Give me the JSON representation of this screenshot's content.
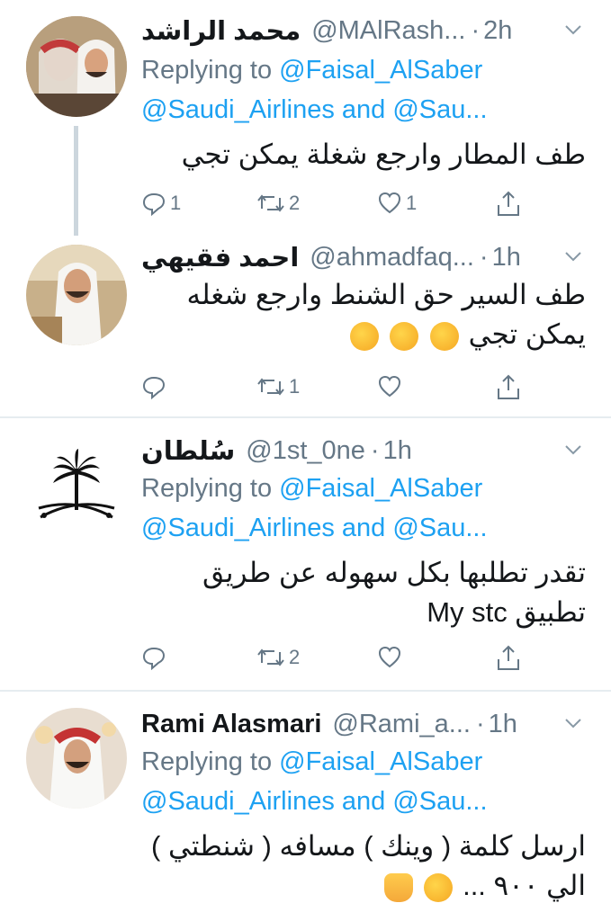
{
  "tweets": [
    {
      "name": "محمد الراشد",
      "handle": "@MAlRash...",
      "time": "2h",
      "replying_prefix": "Replying to",
      "replying_line1": "@Faisal_AlSaber",
      "replying_line2": "@Saudi_Airlines and @Sau...",
      "body": [
        "طف المطار وارجع شغلة يمكن تجي"
      ],
      "counts": {
        "reply": "1",
        "retweet": "2",
        "like": "1"
      },
      "avatar_icon": "person-photo-avatar"
    },
    {
      "name": "احمد فقيهي",
      "handle": "@ahmadfaq...",
      "time": "1h",
      "body": [
        "طف السير حق الشنط وارجع شغله",
        "يمكن تجي"
      ],
      "emojis": [
        "rolling-laughing-emoji",
        "rolling-laughing-emoji",
        "rolling-laughing-emoji"
      ],
      "counts": {
        "reply": "",
        "retweet": "1",
        "like": ""
      },
      "avatar_icon": "person-photo-avatar"
    },
    {
      "name": "سُلطان",
      "handle": "@1st_0ne",
      "time": "1h",
      "replying_prefix": "Replying to",
      "replying_line1": "@Faisal_AlSaber",
      "replying_line2": "@Saudi_Airlines and @Sau...",
      "body": [
        "تقدر تطلبها بكل سهوله عن طريق",
        "تطبيق My stc"
      ],
      "counts": {
        "reply": "",
        "retweet": "2",
        "like": ""
      },
      "avatar_icon": "palm-swords-emblem-icon"
    },
    {
      "name": "Rami Alasmari",
      "handle": "@Rami_a...",
      "time": "1h",
      "replying_prefix": "Replying to",
      "replying_line1": "@Faisal_AlSaber",
      "replying_line2": "@Saudi_Airlines and @Sau...",
      "body": [
        "ارسل كلمة ( وينك ) مسافه ( شنطتي )",
        "الي ٩٠٠ ..."
      ],
      "emojis": [
        "smiling-face-emoji",
        "raised-hand-emoji"
      ],
      "counts": {
        "reply": "",
        "retweet": "",
        "like": ""
      },
      "avatar_icon": "person-photo-avatar"
    }
  ],
  "colors": {
    "accent": "#1da1f2",
    "muted": "#657786",
    "text": "#14171a",
    "divider": "#e6ecf0",
    "thread_line": "#ccd6dd"
  }
}
